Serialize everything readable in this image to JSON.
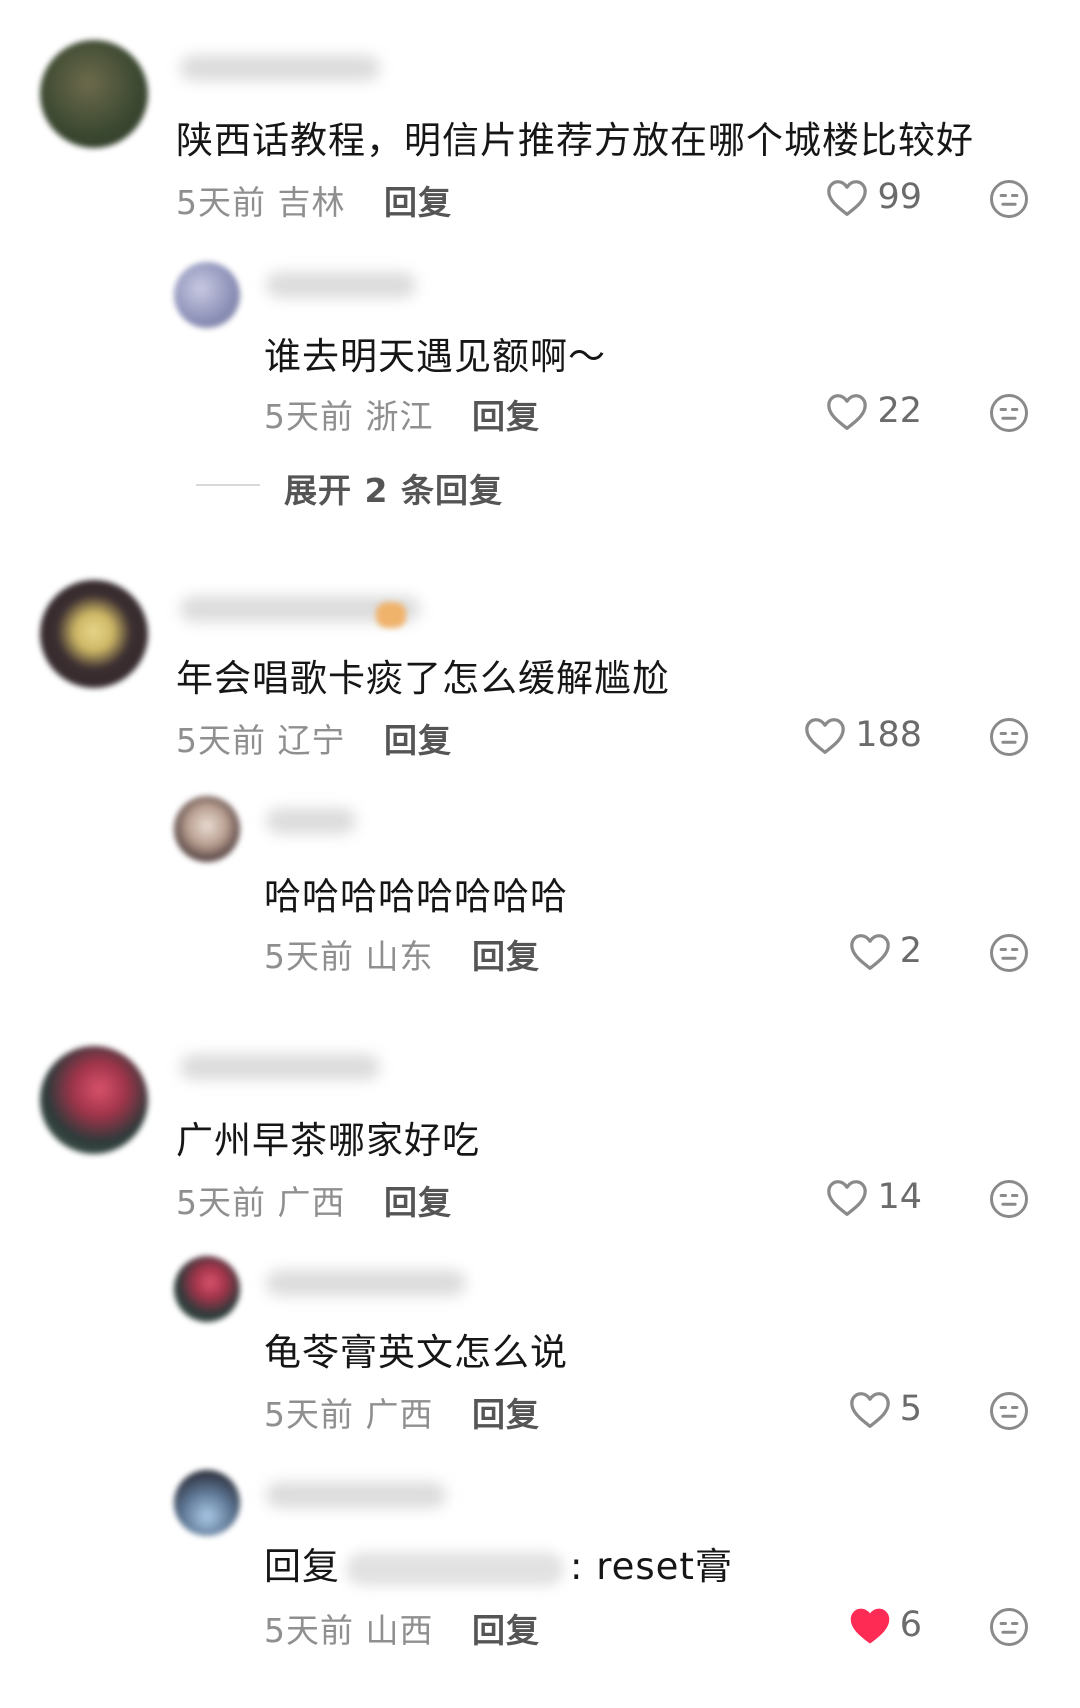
{
  "comments": [
    {
      "text": "陕西话教程，明信片推荐方放在哪个城楼比较好",
      "time": "5天前",
      "location": "吉林",
      "reply_label": "回复",
      "likes": "99",
      "liked": false
    },
    {
      "text": "谁去明天遇见额啊～",
      "time": "5天前",
      "location": "浙江",
      "reply_label": "回复",
      "likes": "22",
      "liked": false
    },
    {
      "text": "年会唱歌卡痰了怎么缓解尴尬",
      "time": "5天前",
      "location": "辽宁",
      "reply_label": "回复",
      "likes": "188",
      "liked": false
    },
    {
      "text": "哈哈哈哈哈哈哈哈",
      "time": "5天前",
      "location": "山东",
      "reply_label": "回复",
      "likes": "2",
      "liked": false
    },
    {
      "text": "广州早茶哪家好吃",
      "time": "5天前",
      "location": "广西",
      "reply_label": "回复",
      "likes": "14",
      "liked": false
    },
    {
      "text": "龟苓膏英文怎么说",
      "time": "5天前",
      "location": "广西",
      "reply_label": "回复",
      "likes": "5",
      "liked": false
    },
    {
      "text_prefix": "回复",
      "text_suffix": ": reset膏",
      "time": "5天前",
      "location": "山西",
      "reply_label": "回复",
      "likes": "6",
      "liked": true
    }
  ],
  "expand_replies": "展开 2 条回复",
  "colors": {
    "like_active": "#fe2c55",
    "icon_gray": "#8a8a8a",
    "meta": "#8f8f8f"
  },
  "icons": {
    "like": "heart-icon",
    "dislike": "neutral-face-icon"
  }
}
